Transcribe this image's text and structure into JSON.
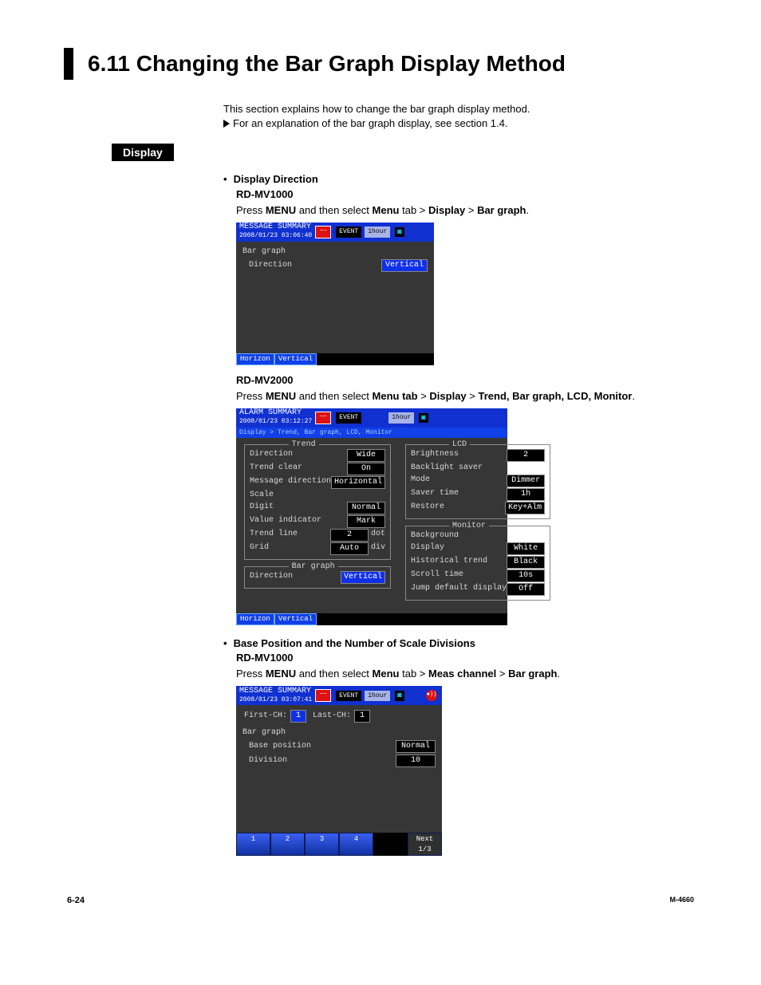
{
  "title": "6.11   Changing the Bar Graph Display Method",
  "intro": {
    "line1": "This section explains how to change the bar graph display method.",
    "line2": "For an explanation of the bar graph display, see section 1.4."
  },
  "section_label": "Display",
  "display_direction": {
    "heading": "Display Direction",
    "mv1000": {
      "label": "RD-MV1000",
      "step_pre": "Press ",
      "menu1": "MENU",
      "step_mid": " and then select ",
      "menu2": "Menu",
      "step_tab": " tab > ",
      "menu3": "Display",
      "step_gt": " > ",
      "menu4": "Bar graph",
      "step_end": "."
    },
    "ss1": {
      "header_title": "MESSAGE SUMMARY",
      "header_date": "2008/01/23 03:06:40",
      "event": "EVENT",
      "time": "1hour",
      "group": "Bar graph",
      "direction_label": "Direction",
      "direction_value": "Vertical",
      "footer_tabs": [
        "Horizon",
        "Vertical"
      ]
    },
    "mv2000": {
      "label": "RD-MV2000",
      "step_pre": "Press ",
      "menu1": "MENU",
      "step_mid": " and then select ",
      "menu2": "Menu tab",
      "step_gt1": " > ",
      "menu3": "Display",
      "step_gt2": " > ",
      "menu4": "Trend, Bar graph, LCD, Monitor",
      "step_end": "."
    },
    "ss2": {
      "header_title": "ALARM SUMMARY",
      "header_date": "2008/01/23 03:12:27",
      "event": "EVENT",
      "time": "1hour",
      "breadcrumb": "Display > Trend, Bar graph, LCD, Monitor",
      "trend": {
        "title": "Trend",
        "rows": [
          {
            "label": "Direction",
            "value": "Wide"
          },
          {
            "label": "Trend clear",
            "value": "On"
          },
          {
            "label": "Message direction",
            "value": "Horizontal"
          },
          {
            "label": "Scale",
            "value": ""
          },
          {
            "label": "Digit",
            "value": "Normal"
          },
          {
            "label": "Value indicator",
            "value": "Mark"
          },
          {
            "label": "Trend line",
            "value": "2",
            "suffix": "dot"
          },
          {
            "label": "Grid",
            "value": "Auto",
            "suffix": "div"
          }
        ]
      },
      "bargraph": {
        "title": "Bar graph",
        "direction_label": "Direction",
        "direction_value": "Vertical"
      },
      "lcd": {
        "title": "LCD",
        "rows": [
          {
            "label": "Brightness",
            "value": "2"
          },
          {
            "label": "Backlight saver",
            "value": ""
          },
          {
            "label": "Mode",
            "value": "Dimmer"
          },
          {
            "label": "Saver time",
            "value": "1h"
          },
          {
            "label": "Restore",
            "value": "Key+Alm"
          }
        ]
      },
      "monitor": {
        "title": "Monitor",
        "rows": [
          {
            "label": "Background",
            "value": ""
          },
          {
            "label": "Display",
            "value": "White"
          },
          {
            "label": "Historical trend",
            "value": "Black"
          },
          {
            "label": "Scroll time",
            "value": "10s"
          },
          {
            "label": "Jump default display",
            "value": "Off"
          }
        ]
      },
      "footer_tabs": [
        "Horizon",
        "Vertical"
      ]
    }
  },
  "base_position": {
    "heading": "Base Position and the Number of Scale Divisions",
    "mv1000": {
      "label": "RD-MV1000",
      "step_pre": "Press ",
      "menu1": "MENU",
      "step_mid": " and then select ",
      "menu2": "Menu",
      "step_tab": " tab > ",
      "menu3": "Meas channel",
      "step_gt": " > ",
      "menu4": "Bar graph",
      "step_end": "."
    },
    "ss3": {
      "header_title": "MESSAGE SUMMARY",
      "header_date": "2008/01/23 03:07:41",
      "event": "EVENT",
      "time": "1hour",
      "first_label": "First-CH:",
      "first_value": "1",
      "last_label": "Last-CH:",
      "last_value": "1",
      "group": "Bar graph",
      "basepos_label": "Base position",
      "basepos_value": "Normal",
      "division_label": "Division",
      "division_value": "10",
      "tabs": [
        "1",
        "2",
        "3",
        "4"
      ],
      "next": "Next 1/3"
    }
  },
  "footer": {
    "page": "6-24",
    "doc": "M-4660"
  }
}
